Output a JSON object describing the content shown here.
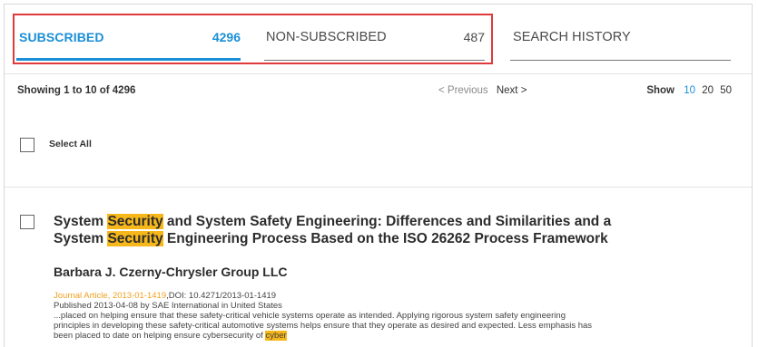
{
  "tabs": {
    "subscribed": {
      "label": "SUBSCRIBED",
      "count": "4296"
    },
    "non_subscribed": {
      "label": "NON-SUBSCRIBED",
      "count": "487"
    },
    "search_history": {
      "label": "SEARCH HISTORY"
    }
  },
  "toolbar": {
    "showing": "Showing 1 to 10 of 4296",
    "previous": "< Previous",
    "next": "Next >",
    "show_label": "Show",
    "page_sizes": [
      "10",
      "20",
      "50"
    ],
    "active_page_size": "10"
  },
  "select_all": {
    "label": "Select All",
    "checked": false
  },
  "result": {
    "title_parts": {
      "a1": "System ",
      "h1": "Security",
      "a2": " and System Safety Engineering: Differences and Similarities and a",
      "a3": "System ",
      "h2": "Security",
      "a4": " Engineering Process Based on the ISO 26262 Process Framework"
    },
    "author": "Barbara J. Czerny-Chrysler Group LLC",
    "type_line": "Journal Article, 2013-01-1419",
    "doi": ",DOI: 10.4271/2013-01-1419",
    "published": "Published 2013-04-08 by SAE International in United States",
    "snippet_l1": "...placed on helping ensure that these safety-critical vehicle systems operate as intended. Applying rigorous system safety engineering",
    "snippet_l2": "principles in developing these safety-critical automotive systems helps ensure that they operate as desired and expected. Less emphasis has",
    "snippet_l3": "been placed to date on helping ensure cybersecurity of ",
    "snippet_hl": "cyber"
  },
  "colors": {
    "accent": "#1a8fd6",
    "highlight": "#f6b71a",
    "annotation_box": "#e03a3a",
    "type_text": "#f0a020"
  }
}
